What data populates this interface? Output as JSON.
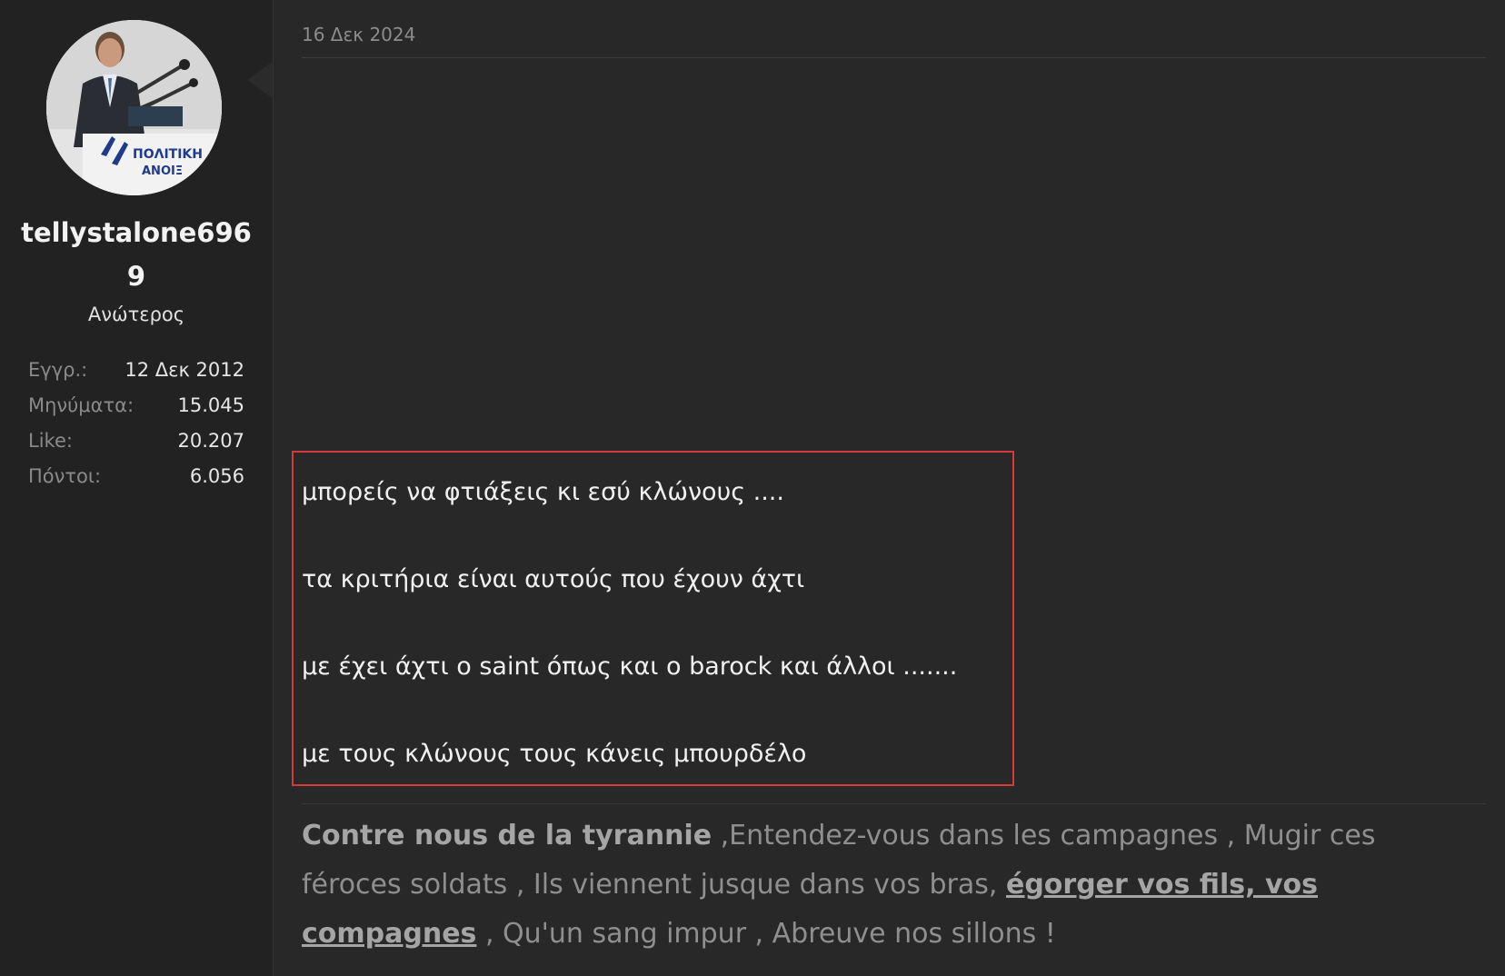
{
  "post": {
    "date": "16 Δεκ 2024",
    "lines": [
      "μπορείς να φτιάξεις κι εσύ κλώνους ....",
      "τα κριτήρια είναι αυτούς που έχουν άχτι",
      "με έχει άχτι ο saint όπως και ο barock και άλλοι .......",
      "με τους κλώνους τους κάνεις μπουρδέλο"
    ]
  },
  "user": {
    "name": "tellystalone6969",
    "title": "Ανώτερος",
    "avatar_text": "ΠΟΛΙΤΙΚΗ ΑΝΟΙΞ",
    "stats": [
      {
        "label": "Εγγρ.:",
        "value": "12 Δεκ 2012"
      },
      {
        "label": "Μηνύματα:",
        "value": "15.045"
      },
      {
        "label": "Like:",
        "value": "20.207"
      },
      {
        "label": "Πόντοι:",
        "value": "6.056"
      }
    ]
  },
  "signature": {
    "bold_intro": "Contre nous de la tyrannie",
    "text_1": " ,Entendez-vous dans les campagnes , Mugir ces féroces soldats , Ils viennent jusque dans vos bras, ",
    "underlined": "égorger vos fils, vos compagnes",
    "text_2": " , Qu'un sang impur , Abreuve nos sillons !"
  },
  "colors": {
    "highlight_border": "#d43a3a",
    "background": "#262626"
  }
}
